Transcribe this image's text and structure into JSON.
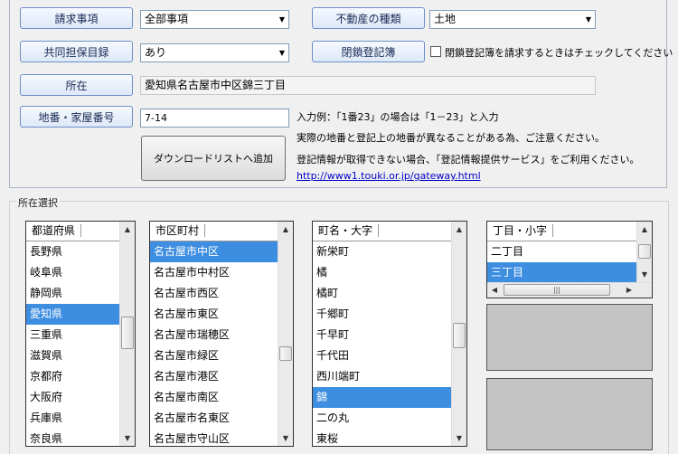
{
  "form": {
    "request_label": "請求事項",
    "request_value": "全部事項",
    "property_type_label": "不動産の種類",
    "property_type_value": "土地",
    "joint_label": "共同担保目録",
    "joint_value": "あり",
    "closed_label": "閉鎖登記簿",
    "closed_check_text": "閉鎖登記簿を請求するときはチェックしてください",
    "location_label": "所在",
    "location_value": "愛知県名古屋市中区錦三丁目",
    "lot_label": "地番・家屋番号",
    "lot_value": "7-14",
    "add_button": "ダウンロードリストへ追加",
    "hint1": "入力例：「1番23」の場合は「1－23」と入力",
    "hint2": "実際の地番と登記上の地番が異なることがある為、ご注意ください。",
    "hint3": "登記情報が取得できない場合、「登記情報提供サービス」をご利用ください。",
    "link": "http://www1.touki.or.jp/gateway.html"
  },
  "selection": {
    "group_title": "所在選択",
    "prefectures": {
      "header": "都道府県",
      "items": [
        "長野県",
        "岐阜県",
        "静岡県",
        "愛知県",
        "三重県",
        "滋賀県",
        "京都府",
        "大阪府",
        "兵庫県",
        "奈良県"
      ],
      "selected_index": 3
    },
    "cities": {
      "header": "市区町村",
      "items": [
        "名古屋市中区",
        "名古屋市中村区",
        "名古屋市西区",
        "名古屋市東区",
        "名古屋市瑞穂区",
        "名古屋市緑区",
        "名古屋市港区",
        "名古屋市南区",
        "名古屋市名東区",
        "名古屋市守山区"
      ],
      "selected_index": 0
    },
    "towns": {
      "header": "町名・大字",
      "items": [
        "新栄町",
        "橘",
        "橘町",
        "千郷町",
        "千早町",
        "千代田",
        "西川端町",
        "錦",
        "二の丸",
        "東桜"
      ],
      "selected_index": 7
    },
    "chome": {
      "header": "丁目・小字",
      "items": [
        "二丁目",
        "三丁目"
      ],
      "selected_index": 1
    }
  },
  "colors": {
    "selection": "#3d8ee0",
    "label_border": "#6d8fc8"
  }
}
